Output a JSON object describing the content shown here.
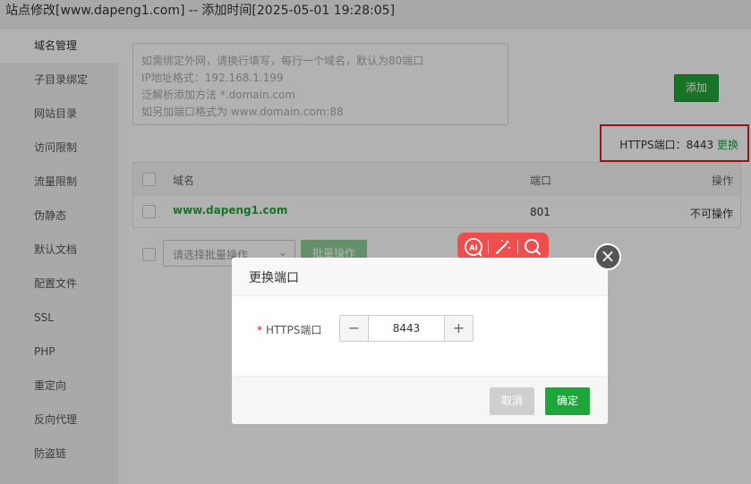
{
  "window": {
    "title": "站点修改[www.dapeng1.com] -- 添加时间[2025-05-01 19:28:05]"
  },
  "sidebar": {
    "items": [
      {
        "label": "域名管理"
      },
      {
        "label": "子目录绑定"
      },
      {
        "label": "网站目录"
      },
      {
        "label": "访问限制"
      },
      {
        "label": "流量限制"
      },
      {
        "label": "伪静态"
      },
      {
        "label": "默认文档"
      },
      {
        "label": "配置文件"
      },
      {
        "label": "SSL"
      },
      {
        "label": "PHP"
      },
      {
        "label": "重定向"
      },
      {
        "label": "反向代理"
      },
      {
        "label": "防盗链"
      }
    ]
  },
  "domain_input": {
    "placeholder_lines": [
      "如需绑定外网，请换行填写，每行一个域名，默认为80端口",
      "IP地址格式：192.168.1.199",
      "泛解析添加方法 *.domain.com",
      "如另加端口格式为 www.domain.com:88"
    ]
  },
  "add_button": {
    "label": "添加"
  },
  "https_port": {
    "label": "HTTPS端口：8443",
    "link": "更换"
  },
  "table": {
    "headers": {
      "domain": "域名",
      "port": "端口",
      "action": "操作"
    },
    "rows": [
      {
        "domain": "www.dapeng1.com",
        "port": "801",
        "action": "不可操作"
      }
    ]
  },
  "batch": {
    "select_placeholder": "请选择批量操作",
    "button": "批量操作"
  },
  "dialog": {
    "title": "更换端口",
    "field_label": "HTTPS端口",
    "field_value": "8443",
    "minus": "−",
    "plus": "+",
    "cancel": "取消",
    "confirm": "确定"
  },
  "ai_toolbar": {
    "icons": [
      "ai-chat-icon",
      "magic-wand-icon",
      "search-icon"
    ]
  },
  "colors": {
    "accent_green": "#20a53a",
    "highlight_red": "#e01a1a",
    "toolbar_red": "#ee4e4e"
  }
}
